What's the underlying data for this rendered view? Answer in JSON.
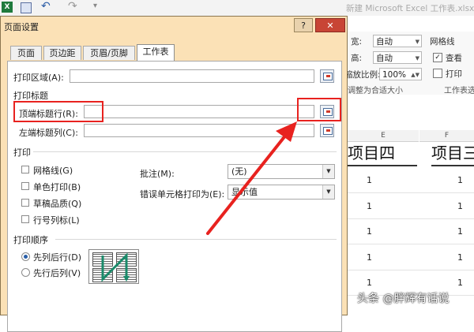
{
  "excel": {
    "logo": "X",
    "title": "新建 Microsoft Excel 工作表.xlsx",
    "ribbon": {
      "width_label": "宽:",
      "width_value": "自动",
      "height_label": "高:",
      "height_value": "自动",
      "scale_label": "缩放比例:",
      "scale_value": "100%",
      "fit_group": "调整为合适大小",
      "gridlines_label": "网格线",
      "view_label": "查看",
      "print_label": "打印",
      "sheet_options_group": "工作表选"
    },
    "columns": [
      "E",
      "F"
    ],
    "header_cells": [
      "项目四",
      "项目三"
    ],
    "cell_value": "1"
  },
  "dialog": {
    "title": "页面设置",
    "help_label": "?",
    "close_label": "✕",
    "tabs": [
      {
        "label": "页面"
      },
      {
        "label": "页边距"
      },
      {
        "label": "页眉/页脚"
      },
      {
        "label": "工作表"
      }
    ],
    "print_area_label": "打印区域(A):",
    "print_titles_section": "打印标题",
    "top_rows_label": "顶端标题行(R):",
    "left_cols_label": "左端标题列(C):",
    "print_section": "打印",
    "checkboxes": [
      {
        "label": "网格线(G)"
      },
      {
        "label": "单色打印(B)"
      },
      {
        "label": "草稿品质(Q)"
      },
      {
        "label": "行号列标(L)"
      }
    ],
    "comments_label": "批注(M):",
    "comments_value": "(无)",
    "errors_label": "错误单元格打印为(E):",
    "errors_value": "显示值",
    "order_section": "打印顺序",
    "order_options": [
      {
        "label": "先列后行(D)",
        "selected": true
      },
      {
        "label": "先行后列(V)",
        "selected": false
      }
    ]
  },
  "watermark": "头条 @胖辉有话说",
  "colors": {
    "highlight": "#e8221f",
    "dialog_frame": "#fbe1b6",
    "close_button": "#c84535"
  }
}
